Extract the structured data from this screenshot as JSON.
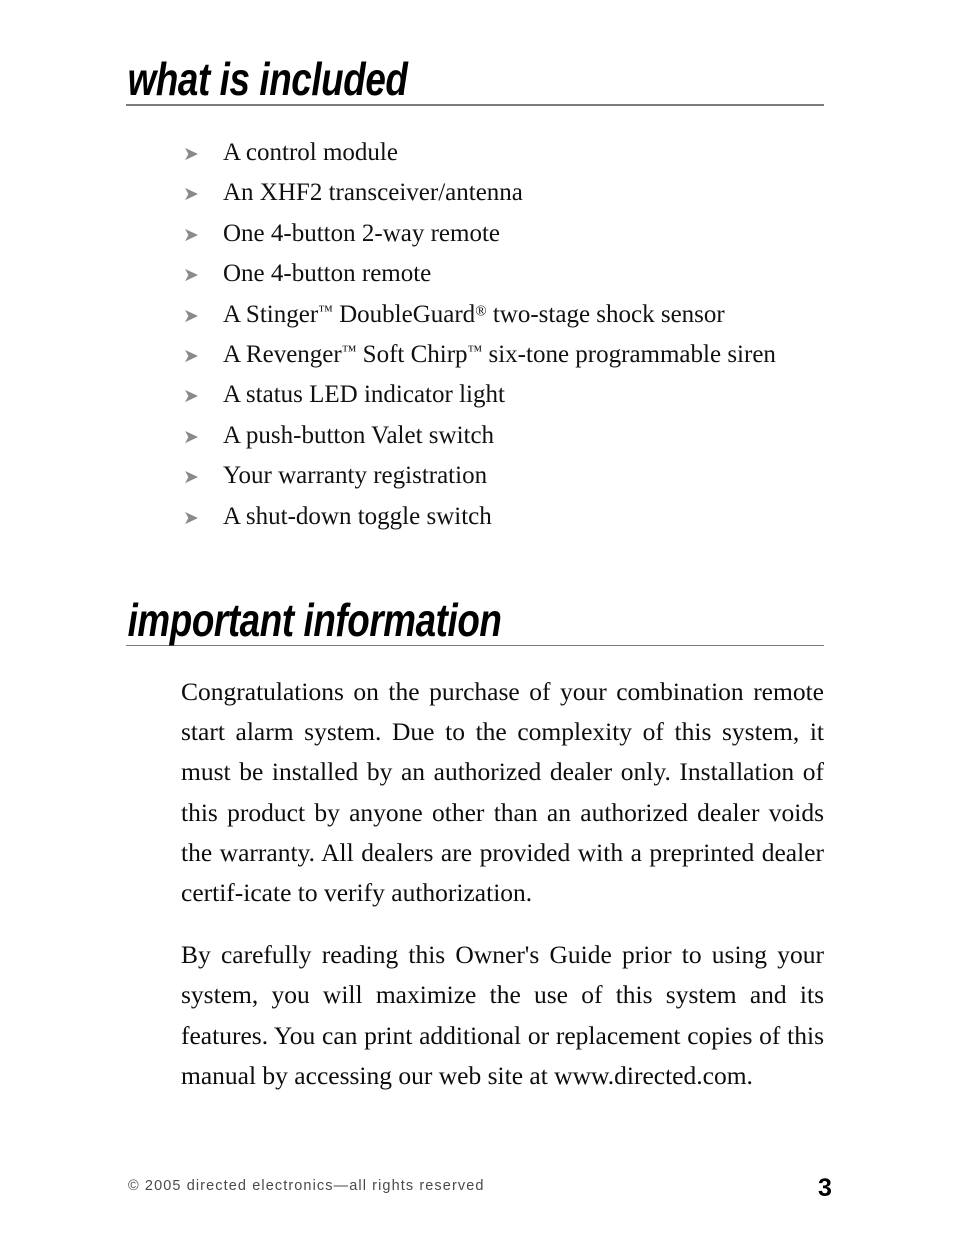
{
  "document": {
    "page_number": "3",
    "footer_copyright": "© 2005 directed electronics—all rights reserved",
    "accent_rule_color": "#7b7b7b",
    "bullet_marker_color": "#8a8a8a",
    "text_color": "#000000"
  },
  "sections": [
    {
      "heading": "what is included",
      "bullet_marker": "➤",
      "items": [
        {
          "text": "A control module"
        },
        {
          "text": "An XHF2 transceiver/antenna"
        },
        {
          "text": "One 4-button 2-way remote"
        },
        {
          "text": "One 4-button remote"
        },
        {
          "text": "A Stinger™ DoubleGuard® two-stage shock sensor"
        },
        {
          "text": "A Revenger™ Soft Chirp™ six-tone programmable siren"
        },
        {
          "text": "A status LED indicator light"
        },
        {
          "text": "A push-button Valet switch"
        },
        {
          "text": "Your warranty registration"
        },
        {
          "text": "A shut-down toggle switch"
        }
      ]
    },
    {
      "heading": "important information",
      "paragraphs": [
        "Congratulations on the purchase of your combination remote start alarm system. Due to the complexity of this system, it must be installed by an authorized dealer only. Installation of this product by anyone other than an authorized dealer voids the warranty. All dealers are provided with a preprinted dealer certif-icate to verify authorization.",
        "By carefully reading this Owner's Guide prior to using your system, you will maximize the use of this system and its features. You can print additional or replacement copies of this manual by accessing our web site at www.directed.com."
      ]
    }
  ]
}
